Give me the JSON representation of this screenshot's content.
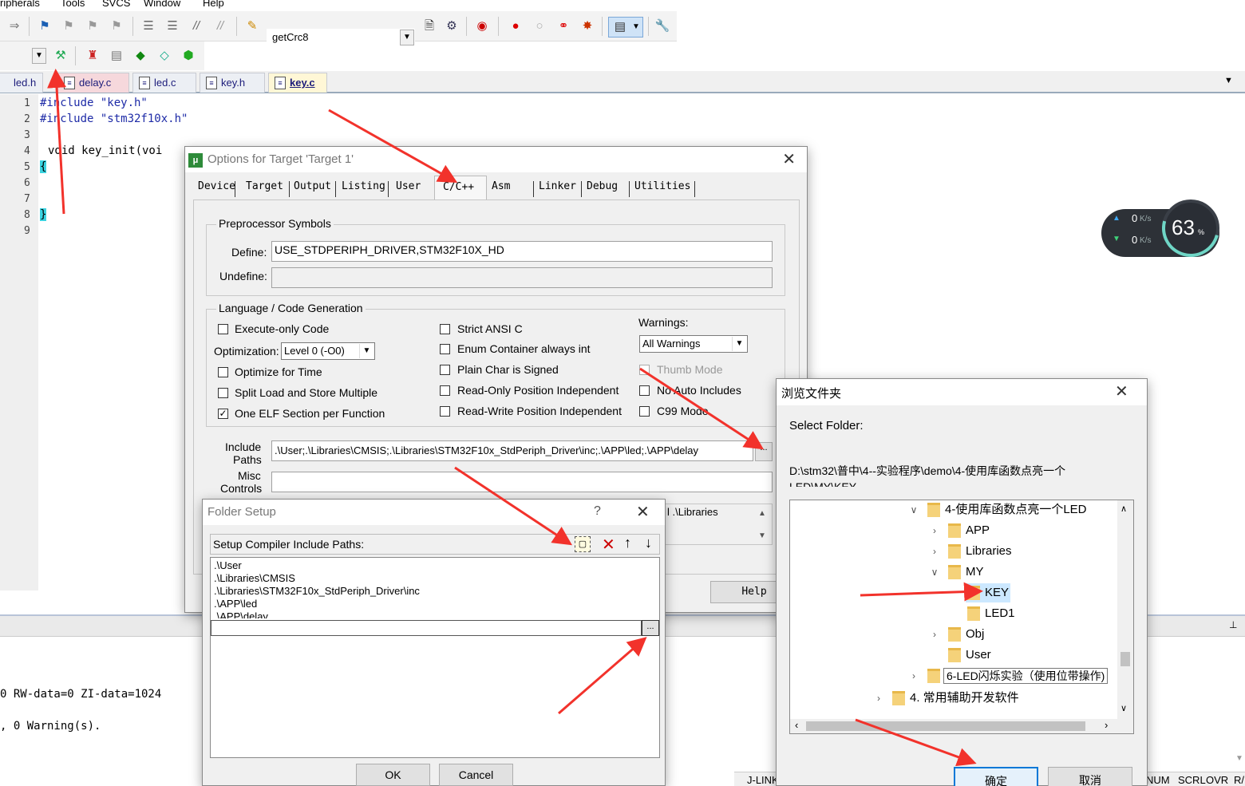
{
  "menu": [
    "ripherals",
    "Tools",
    "SVCS",
    "Window",
    "Help"
  ],
  "toolbar": {
    "target_name": "getCrc8"
  },
  "file_tabs": [
    {
      "label": "led.h"
    },
    {
      "label": "delay.c"
    },
    {
      "label": "led.c"
    },
    {
      "label": "key.h"
    },
    {
      "label": "key.c"
    }
  ],
  "editor": {
    "line_numbers": [
      "1",
      "2",
      "3",
      "4",
      "5",
      "6",
      "7",
      "8",
      "9"
    ],
    "lines": [
      "#include \"key.h\"",
      "#include \"stm32f10x.h\"",
      "",
      "void key_init(voi",
      "{",
      "",
      "",
      "}",
      ""
    ]
  },
  "build_output": {
    "line1": "0 RW-data=0 ZI-data=1024",
    "line2": ", 0 Warning(s)."
  },
  "status_bar": [
    "J-LINK",
    "NUM",
    "SCRL",
    "OVR",
    "R/"
  ],
  "net_widget": {
    "up": "0",
    "down": "0",
    "unit": "K/s",
    "percent": "63",
    "percent_unit": "%"
  },
  "options_dialog": {
    "title": "Options for Target 'Target 1'",
    "tabs": [
      "Device",
      "Target",
      "Output",
      "Listing",
      "User",
      "C/C++",
      "Asm",
      "Linker",
      "Debug",
      "Utilities"
    ],
    "active_tab": "C/C++",
    "preprocessor": {
      "group_title": "Preprocessor Symbols",
      "define_label": "Define:",
      "define_value": "USE_STDPERIPH_DRIVER,STM32F10X_HD",
      "undefine_label": "Undefine:",
      "undefine_value": ""
    },
    "language": {
      "group_title": "Language / Code Generation",
      "execute_only": "Execute-only Code",
      "optimization_label": "Optimization:",
      "optimization_value": "Level 0 (-O0)",
      "optimize_time": "Optimize for Time",
      "split_load": "Split Load and Store Multiple",
      "one_elf": "One ELF Section per Function",
      "strict_ansi": "Strict ANSI C",
      "enum_container": "Enum Container always int",
      "plain_char": "Plain Char is Signed",
      "ro_pi": "Read-Only Position Independent",
      "rw_pi": "Read-Write Position Independent",
      "warnings_label": "Warnings:",
      "warnings_value": "All Warnings",
      "thumb_mode": "Thumb Mode",
      "no_auto_includes": "No Auto Includes",
      "c99_mode": "C99 Mode"
    },
    "include_paths_label_1": "Include",
    "include_paths_label_2": "Paths",
    "include_paths_value": ".\\User;.\\Libraries\\CMSIS;.\\Libraries\\STM32F10x_StdPeriph_Driver\\inc;.\\APP\\led;.\\APP\\delay",
    "browse_label": "...",
    "misc_label_1": "Misc",
    "misc_label_2": "Controls",
    "compiler_partial": "l .\\Libraries",
    "help_button": "Help"
  },
  "folder_setup": {
    "title": "Folder Setup",
    "help_q": "?",
    "header_label": "Setup Compiler Include Paths:",
    "paths": [
      ".\\User",
      ".\\Libraries\\CMSIS",
      ".\\Libraries\\STM32F10x_StdPeriph_Driver\\inc",
      ".\\APP\\led",
      ".\\APP\\delay"
    ],
    "browse_label": "...",
    "ok": "OK",
    "cancel": "Cancel"
  },
  "browse_dialog": {
    "title": "浏览文件夹",
    "prompt": "Select Folder:",
    "path_line1": "D:\\stm32\\普中\\4--实验程序\\demo\\4-使用库函数点亮一个",
    "path_line2": "LED\\MY\\KEY",
    "tree": [
      {
        "label": "4-使用库函数点亮一个LED"
      },
      {
        "label": "APP"
      },
      {
        "label": "Libraries"
      },
      {
        "label": "MY"
      },
      {
        "label": "KEY"
      },
      {
        "label": "LED1"
      },
      {
        "label": "Obj"
      },
      {
        "label": "User"
      },
      {
        "label": "6-LED闪烁实验（使用位带操作)"
      },
      {
        "label": "4. 常用辅助开发软件"
      }
    ],
    "ok": "确定",
    "cancel": "取消"
  },
  "colors": {
    "arrow": "#f2322b",
    "selection": "#cce8ff",
    "accent": "#0078d7"
  }
}
